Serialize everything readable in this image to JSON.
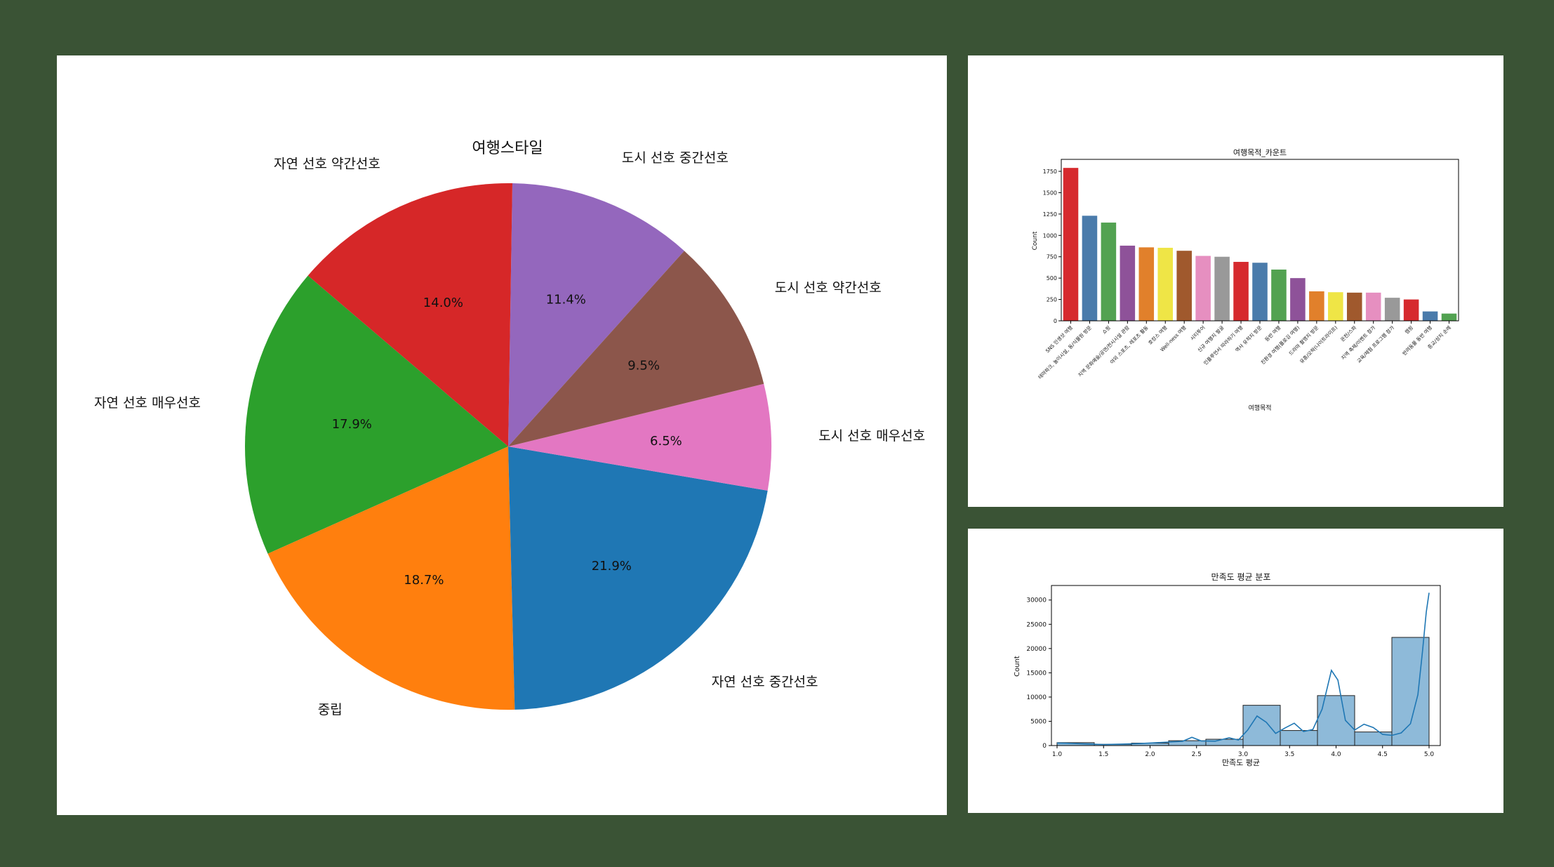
{
  "pie_chart": {
    "title": "여행스타일",
    "slices": [
      {
        "label": "도시 선호 중간선호",
        "value": 11.4,
        "pct_label": "11.4%",
        "color": "#9467bd"
      },
      {
        "label": "자연 선호 약간선호",
        "value": 14.0,
        "pct_label": "14.0%",
        "color": "#d62728"
      },
      {
        "label": "자연 선호 매우선호",
        "value": 17.9,
        "pct_label": "17.9%",
        "color": "#2ca02c"
      },
      {
        "label": "중립",
        "value": 18.7,
        "pct_label": "18.7%",
        "color": "#ff7f0e"
      },
      {
        "label": "자연 선호 중간선호",
        "value": 21.9,
        "pct_label": "21.9%",
        "color": "#1f77b4"
      },
      {
        "label": "도시 선호 매우선호",
        "value": 6.5,
        "pct_label": "6.5%",
        "color": "#e377c2"
      },
      {
        "label": "도시 선호 약간선호",
        "value": 9.5,
        "pct_label": "9.5%",
        "color": "#8c564b"
      }
    ]
  },
  "chart_data": [
    {
      "type": "pie",
      "title": "여행스타일",
      "categories": [
        "도시 선호 중간선호",
        "자연 선호 약간선호",
        "자연 선호 매우선호",
        "중립",
        "자연 선호 중간선호",
        "도시 선호 매우선호",
        "도시 선호 약간선호"
      ],
      "values": [
        11.4,
        14.0,
        17.9,
        18.7,
        21.9,
        6.5,
        9.5
      ]
    },
    {
      "type": "bar",
      "title": "여행목적_카운트",
      "xlabel": "여행목적",
      "ylabel": "Count",
      "ylim": [
        0,
        1890
      ],
      "yticks": [
        0,
        250,
        500,
        750,
        1000,
        1250,
        1500,
        1750
      ],
      "categories": [
        "SNS 인생샷 여행",
        "테마파크, 놀이시설, 동/식물원 방문",
        "쇼핑",
        "지역 문화예술/공연/전시시설 관람",
        "야외 스포츠, 레포츠 활동",
        "호캉스 여행",
        "Well-ness 여행",
        "시티투어",
        "신규 여행지 발굴",
        "인플루언서 따라하기 여행",
        "역사 유적지 방문",
        "등반 여행",
        "친환경 여행(플로깅 여행)",
        "드라마 촬영지 방문",
        "유흥/오락(나이트라이프)",
        "온천/스파",
        "지역 축제/이벤트 참가",
        "교육/체험 프로그램 참가",
        "캠핑",
        "반려동물 동반 여행",
        "종교/성지 순례"
      ],
      "values": [
        1790,
        1230,
        1150,
        880,
        860,
        855,
        820,
        760,
        750,
        690,
        680,
        600,
        500,
        345,
        335,
        330,
        330,
        270,
        250,
        110,
        85
      ],
      "colors": [
        "#d62a2e",
        "#4a7bab",
        "#52a251",
        "#8e5299",
        "#e1802b",
        "#efe546",
        "#a0592d",
        "#e68fc0",
        "#999999",
        "#d62a2e",
        "#4a7bab",
        "#52a251",
        "#8e5299",
        "#e1802b",
        "#efe546",
        "#a0592d",
        "#e68fc0",
        "#999999",
        "#d62a2e",
        "#4a7bab",
        "#52a251"
      ]
    },
    {
      "type": "histogram",
      "title": "만족도 평균 분포",
      "xlabel": "만족도 평균",
      "ylabel": "Count",
      "xlim": [
        1.0,
        5.0
      ],
      "ylim": [
        0,
        33000
      ],
      "xticks": [
        1.0,
        1.5,
        2.0,
        2.5,
        3.0,
        3.5,
        4.0,
        4.5,
        5.0
      ],
      "xtick_labels": [
        "1.0",
        "1.5",
        "2.0",
        "2.5",
        "3.0",
        "3.5",
        "4.0",
        "4.5",
        "5.0"
      ],
      "yticks": [
        0,
        5000,
        10000,
        15000,
        20000,
        25000,
        30000
      ],
      "bins": [
        1.0,
        1.4,
        1.8,
        2.2,
        2.6,
        3.0,
        3.4,
        3.8,
        4.2,
        4.6,
        5.0
      ],
      "counts": [
        600,
        250,
        500,
        1000,
        1300,
        8300,
        3100,
        10300,
        2800,
        22300
      ],
      "kde": [
        [
          1.0,
          520
        ],
        [
          1.1,
          480
        ],
        [
          1.3,
          330
        ],
        [
          1.5,
          220
        ],
        [
          1.7,
          300
        ],
        [
          1.9,
          420
        ],
        [
          2.05,
          560
        ],
        [
          2.2,
          730
        ],
        [
          2.35,
          880
        ],
        [
          2.45,
          1700
        ],
        [
          2.55,
          950
        ],
        [
          2.7,
          900
        ],
        [
          2.85,
          1600
        ],
        [
          2.95,
          1150
        ],
        [
          3.05,
          3200
        ],
        [
          3.15,
          6100
        ],
        [
          3.25,
          4800
        ],
        [
          3.35,
          2500
        ],
        [
          3.45,
          3600
        ],
        [
          3.55,
          4600
        ],
        [
          3.65,
          2900
        ],
        [
          3.75,
          3300
        ],
        [
          3.85,
          7500
        ],
        [
          3.95,
          15500
        ],
        [
          4.02,
          13500
        ],
        [
          4.1,
          5200
        ],
        [
          4.2,
          3200
        ],
        [
          4.3,
          4400
        ],
        [
          4.4,
          3700
        ],
        [
          4.5,
          2300
        ],
        [
          4.6,
          2100
        ],
        [
          4.7,
          2600
        ],
        [
          4.8,
          4500
        ],
        [
          4.88,
          10500
        ],
        [
          4.93,
          19500
        ],
        [
          4.97,
          27500
        ],
        [
          5.0,
          31500
        ]
      ],
      "bar_color": "#8ebad9",
      "line_color": "#1f77b4"
    }
  ]
}
